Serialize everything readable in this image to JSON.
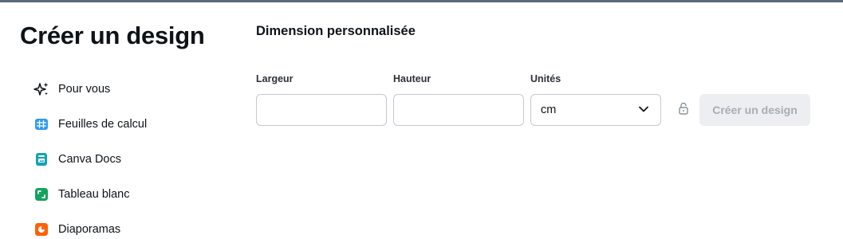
{
  "dialog": {
    "title": "Créer un design"
  },
  "sidebar": {
    "items": [
      {
        "label": "Pour vous",
        "icon": "sparkles-icon",
        "color": "#0e1318"
      },
      {
        "label": "Feuilles de calcul",
        "icon": "spreadsheet-icon",
        "color": "#2d9bf0"
      },
      {
        "label": "Canva Docs",
        "icon": "docs-icon",
        "color": "#13a3b5"
      },
      {
        "label": "Tableau blanc",
        "icon": "whiteboard-icon",
        "color": "#12a45c"
      },
      {
        "label": "Diaporamas",
        "icon": "presentation-icon",
        "color": "#ff6105"
      }
    ]
  },
  "custom_size": {
    "title": "Dimension personnalisée",
    "width_label": "Largeur",
    "width_value": "",
    "height_label": "Hauteur",
    "height_value": "",
    "units_label": "Unités",
    "units_value": "cm",
    "lock_icon": "lock-icon",
    "create_button": "Créer un design"
  },
  "colors": {
    "text": "#0e1318",
    "border": "#c5c9cf",
    "disabled_bg": "#eceef1",
    "disabled_text": "#a8adb4"
  }
}
